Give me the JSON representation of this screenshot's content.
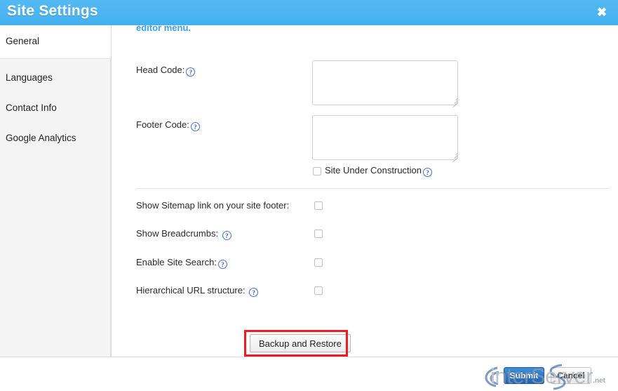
{
  "window": {
    "title": "Site Settings",
    "close_icon": "close-icon",
    "close_glyph": "✖",
    "accent_color": "#4bb3f0"
  },
  "sidebar": {
    "active_item": {
      "label": "General"
    },
    "items": [
      {
        "label": "Languages"
      },
      {
        "label": "Contact Info"
      },
      {
        "label": "Google Analytics"
      }
    ]
  },
  "content": {
    "scroll_note": "editor menu.",
    "fields": [
      {
        "label": "Head Code:",
        "help": "?",
        "value": "",
        "placeholder": ""
      },
      {
        "label": "Footer Code:",
        "help": "?",
        "value": "",
        "placeholder": ""
      }
    ],
    "site_under_construction": {
      "label": "Site Under Construction",
      "help": "?",
      "checked": false
    },
    "options": [
      {
        "label": "Show Sitemap link on your site footer:",
        "help": "",
        "checked": false
      },
      {
        "label": "Show Breadcrumbs:",
        "help": "?",
        "checked": false
      },
      {
        "label": "Enable Site Search:",
        "help": "?",
        "checked": false
      },
      {
        "label": "Hierarchical URL structure:",
        "help": "?",
        "checked": false
      }
    ],
    "backup_button": "Backup and Restore",
    "highlight_color": "#ee1c20"
  },
  "footer": {
    "submit_label": "Submit",
    "cancel_label": "Cancel"
  },
  "watermark": {
    "text": "interServer",
    "tld": ".net"
  }
}
